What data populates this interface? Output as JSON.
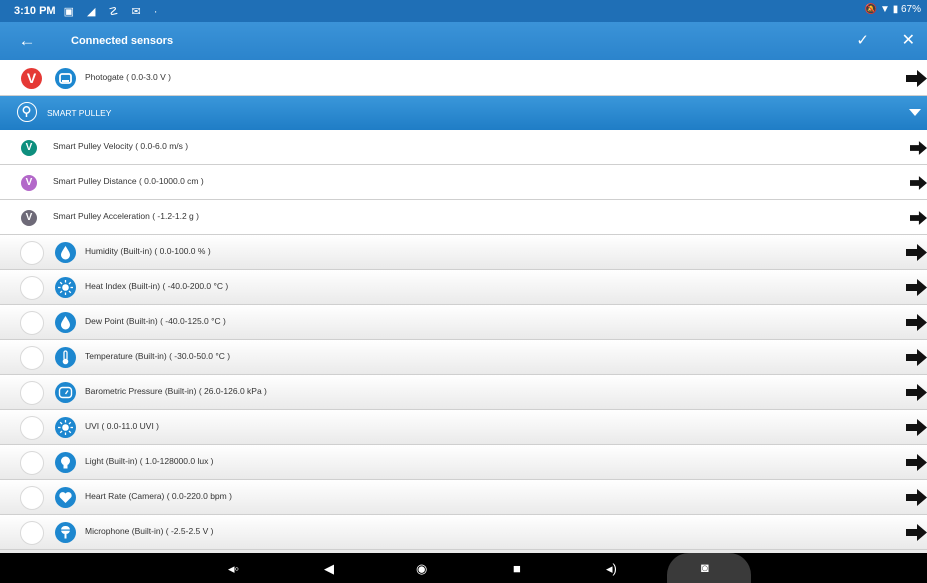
{
  "status_bar": {
    "time": "3:10 PM",
    "battery": "67%"
  },
  "app_bar": {
    "title": "Connected sensors"
  },
  "rows": {
    "photogate": "Photogate ( 0.0-3.0 V )",
    "section_title": "SMART PULLEY",
    "velocity": "Smart Pulley Velocity ( 0.0-6.0 m/s )",
    "distance": "Smart Pulley Distance ( 0.0-1000.0 cm )",
    "acceleration": "Smart Pulley Acceleration ( -1.2-1.2 g )",
    "humidity": "Humidity (Built-in) ( 0.0-100.0 % )",
    "heat_index": "Heat Index (Built-in) ( -40.0-200.0 °C )",
    "dew_point": "Dew Point (Built-in) ( -40.0-125.0 °C )",
    "temperature": "Temperature (Built-in) ( -30.0-50.0 °C )",
    "barometric": "Barometric Pressure (Built-in) ( 26.0-126.0 kPa )",
    "uvi": "UVI ( 0.0-11.0 UVI )",
    "light": "Light (Built-in) ( 1.0-128000.0 lux )",
    "heart_rate": "Heart Rate (Camera) ( 0.0-220.0 bpm )",
    "microphone": "Microphone (Built-in) ( -2.5-2.5 V )"
  },
  "badges": {
    "checked": "V",
    "velocity": "V",
    "distance": "V",
    "acceleration": "V"
  },
  "colors": {
    "accent": "#1d87cf",
    "checked_red": "#e53935",
    "velocity_teal": "#0e8f7e",
    "distance_purple": "#b368c9",
    "accel_gray": "#6e6a78"
  },
  "icons": [
    "back-arrow-icon",
    "check-icon",
    "close-icon",
    "photogate-icon",
    "pulley-icon",
    "humidity-icon",
    "sun-icon",
    "drop-icon",
    "thermometer-icon",
    "gauge-icon",
    "bulb-icon",
    "heart-icon",
    "microphone-icon",
    "right-arrow-icon",
    "camera-icon"
  ]
}
